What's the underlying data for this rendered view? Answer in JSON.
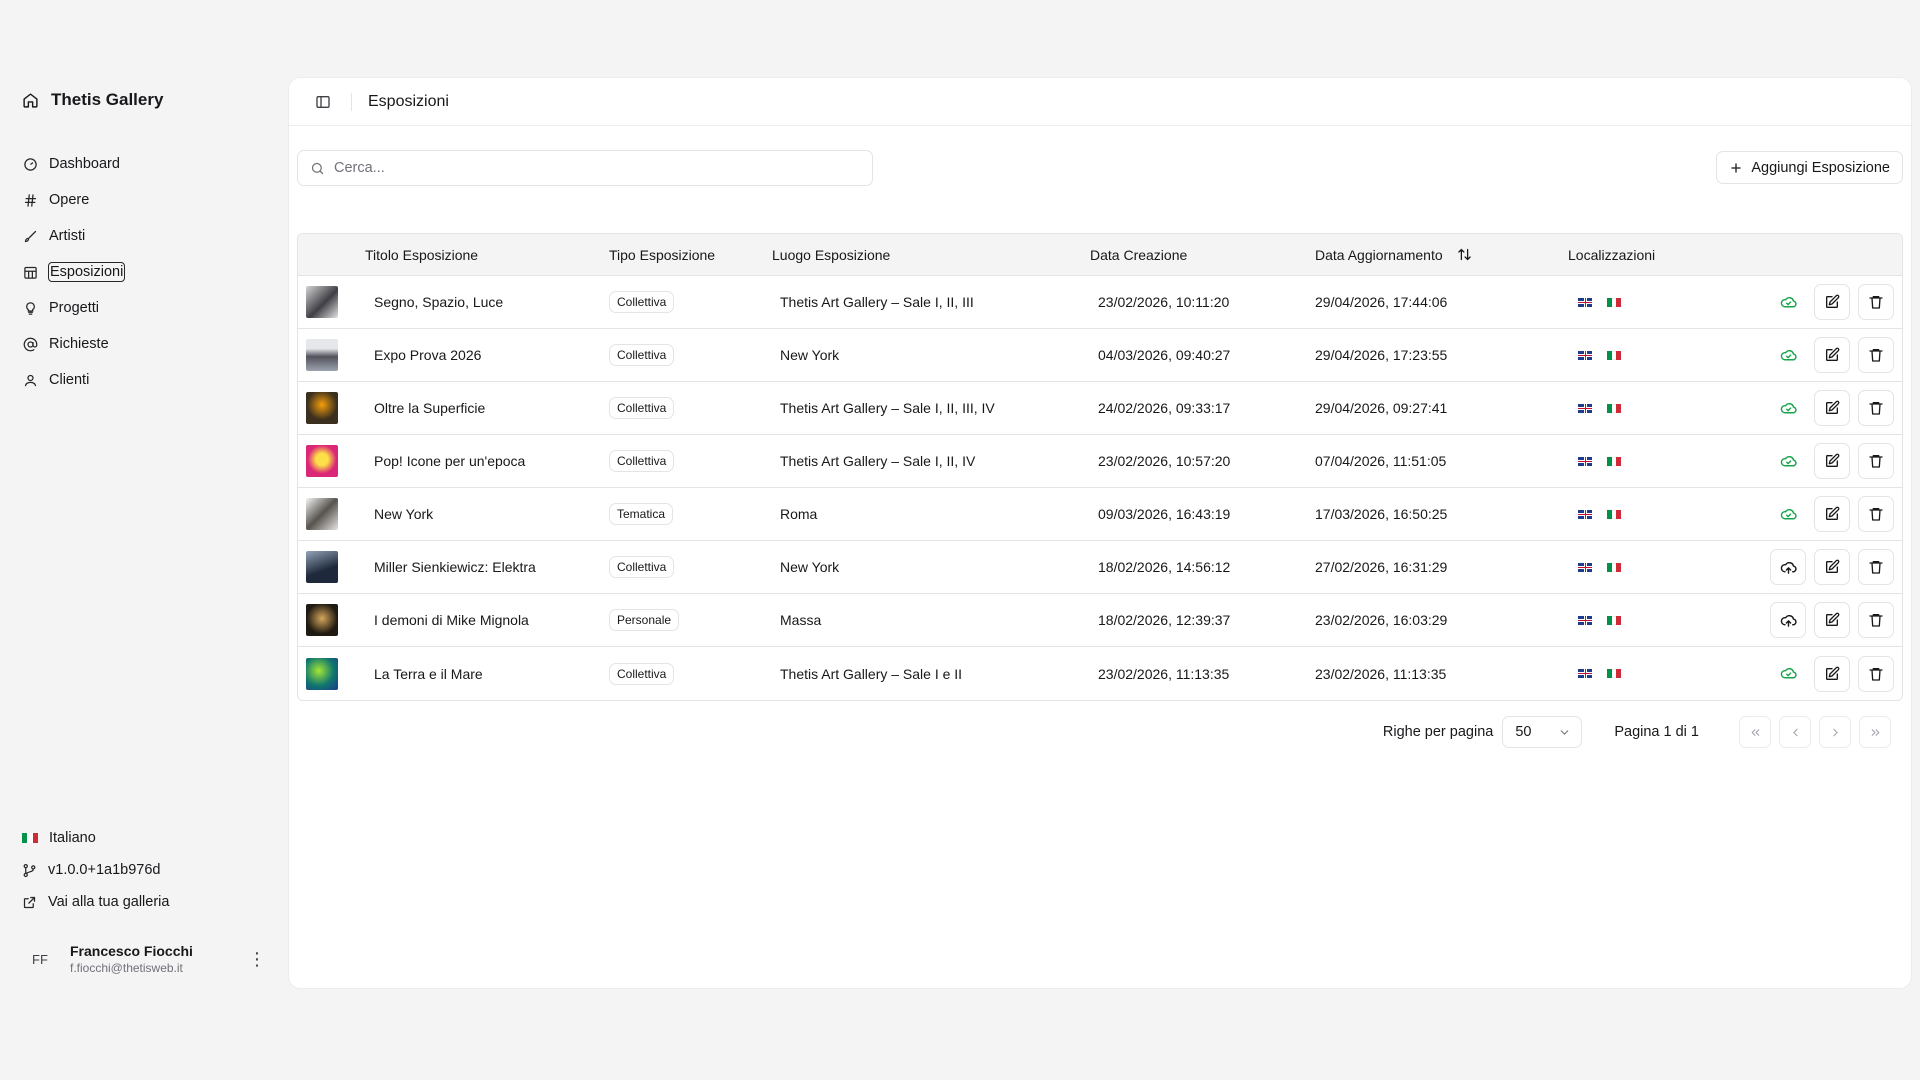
{
  "sidebar": {
    "brand": "Thetis Gallery",
    "items": [
      {
        "label": "Dashboard",
        "icon": "gauge-icon"
      },
      {
        "label": "Opere",
        "icon": "hash-icon"
      },
      {
        "label": "Artisti",
        "icon": "brush-icon"
      },
      {
        "label": "Esposizioni",
        "icon": "calendar-grid-icon",
        "active": true
      },
      {
        "label": "Progetti",
        "icon": "lightbulb-icon"
      },
      {
        "label": "Richieste",
        "icon": "at-sign-icon"
      },
      {
        "label": "Clienti",
        "icon": "user-icon"
      }
    ],
    "language": "Italiano",
    "version": "v1.0.0+1a1b976d",
    "gallery_link": "Vai alla tua galleria",
    "user": {
      "initials": "FF",
      "name": "Francesco Fiocchi",
      "email": "f.fiocchi@thetisweb.it"
    }
  },
  "header": {
    "title": "Esposizioni"
  },
  "search": {
    "placeholder": "Cerca..."
  },
  "toolbar": {
    "add_label": "Aggiungi Esposizione"
  },
  "table": {
    "columns": [
      "Titolo Esposizione",
      "Tipo Esposizione",
      "Luogo Esposizione",
      "Data Creazione",
      "Data Aggiornamento",
      "Localizzazioni"
    ],
    "rows": [
      {
        "title": "Segno, Spazio, Luce",
        "type": "Collettiva",
        "place": "Thetis Art Gallery – Sale I, II, III",
        "created": "23/02/2026, 10:11:20",
        "updated": "29/04/2026, 17:44:06",
        "synced": true
      },
      {
        "title": "Expo Prova 2026",
        "type": "Collettiva",
        "place": "New York",
        "created": "04/03/2026, 09:40:27",
        "updated": "29/04/2026, 17:23:55",
        "synced": true
      },
      {
        "title": "Oltre la Superficie",
        "type": "Collettiva",
        "place": "Thetis Art Gallery – Sale I, II, III, IV",
        "created": "24/02/2026, 09:33:17",
        "updated": "29/04/2026, 09:27:41",
        "synced": true
      },
      {
        "title": "Pop! Icone per un'epoca",
        "type": "Collettiva",
        "place": "Thetis Art Gallery – Sale I, II, IV",
        "created": "23/02/2026, 10:57:20",
        "updated": "07/04/2026, 11:51:05",
        "synced": true
      },
      {
        "title": "New York",
        "type": "Tematica",
        "place": "Roma",
        "created": "09/03/2026, 16:43:19",
        "updated": "17/03/2026, 16:50:25",
        "synced": true
      },
      {
        "title": "Miller Sienkiewicz: Elektra",
        "type": "Collettiva",
        "place": "New York",
        "created": "18/02/2026, 14:56:12",
        "updated": "27/02/2026, 16:31:29",
        "synced": false
      },
      {
        "title": "I demoni di Mike Mignola",
        "type": "Personale",
        "place": "Massa",
        "created": "18/02/2026, 12:39:37",
        "updated": "23/02/2026, 16:03:29",
        "synced": false
      },
      {
        "title": "La Terra e il Mare",
        "type": "Collettiva",
        "place": "Thetis Art Gallery – Sale I e II",
        "created": "23/02/2026, 11:13:35",
        "updated": "23/02/2026, 11:13:35",
        "synced": true
      }
    ]
  },
  "pagination": {
    "rows_label": "Righe per pagina",
    "rows_value": "50",
    "page_info": "Pagina 1 di 1"
  },
  "colors": {
    "accent": "#18181b",
    "sync_ok": "#16a34a",
    "border": "#e4e4e7",
    "header_bg": "#f4f4f5"
  }
}
